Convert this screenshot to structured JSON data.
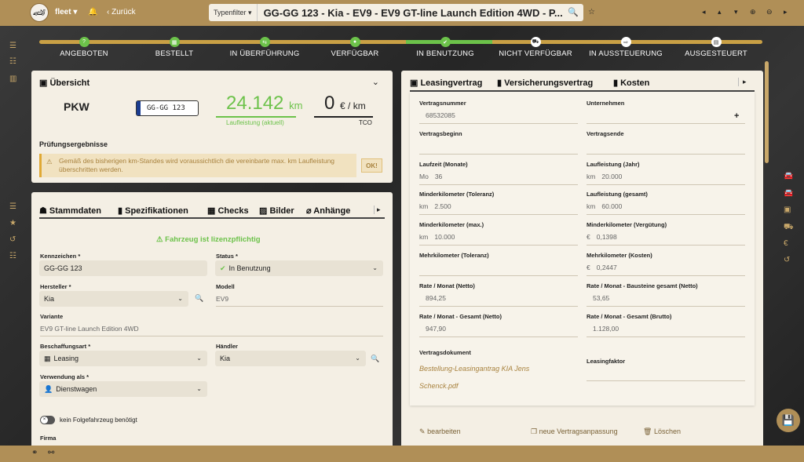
{
  "topbar": {
    "user": "fleet",
    "back_label": "Zurück",
    "filter_label": "Typenfilter",
    "title": "GG-GG 123 - Kia - EV9 - EV9 GT-line Launch Edition 4WD - P...",
    "avatar_icon": "avatar-driver-icon",
    "bell_icon": "bell-icon",
    "search_icon": "search-icon",
    "star_icon": "star-icon"
  },
  "progress": {
    "steps": [
      {
        "label": "ANGEBOTEN",
        "icon": "?"
      },
      {
        "label": "BESTELLT",
        "icon": "▦"
      },
      {
        "label": "IN ÜBERFÜHRUNG",
        "icon": "⇆"
      },
      {
        "label": "VERFÜGBAR",
        "icon": "●"
      },
      {
        "label": "IN BENUTZUNG",
        "icon": "✔"
      },
      {
        "label": "NICHT VERFÜGBAR",
        "icon": "⛟"
      },
      {
        "label": "IN AUSSTEUERUNG",
        "icon": "⇨"
      },
      {
        "label": "AUSGESTEUERT",
        "icon": "▤"
      }
    ]
  },
  "overview": {
    "title": "Übersicht",
    "vehicle_type": "PKW",
    "plate": "GG-GG 123",
    "mileage_value": "24.142",
    "mileage_unit": "km",
    "mileage_label": "Laufleistung (aktuell)",
    "tco_value": "0",
    "tco_unit": "€ / km",
    "tco_label": "TCO",
    "check_title": "Prüfungsergebnisse",
    "warning_text": "Gemäß des bisherigen km-Standes wird voraussichtlich die vereinbarte max. km Laufleistung überschritten werden.",
    "ok_button": "OK!"
  },
  "master": {
    "tabs": [
      "Stammdaten",
      "Spezifikationen",
      "Checks",
      "Bilder",
      "Anhänge"
    ],
    "license_notice": "Fahrzeug ist lizenzpflichtig",
    "fields": {
      "kennzeichen_label": "Kennzeichen *",
      "kennzeichen_value": "GG-GG 123",
      "status_label": "Status *",
      "status_value": "In Benutzung",
      "hersteller_label": "Hersteller *",
      "hersteller_value": "Kia",
      "modell_label": "Modell",
      "modell_value": "EV9",
      "variante_label": "Variante",
      "variante_value": "EV9 GT-line Launch Edition 4WD",
      "beschaffung_label": "Beschaffungsart *",
      "beschaffung_value": "Leasing",
      "haendler_label": "Händler",
      "haendler_value": "Kia",
      "verwendung_label": "Verwendung als *",
      "verwendung_value": "Dienstwagen",
      "toggle_label": "kein Folgefahrzeug benötigt",
      "firma_label": "Firma"
    }
  },
  "contract": {
    "tabs": [
      "Leasingvertrag",
      "Versicherungsvertrag",
      "Kosten"
    ],
    "left": [
      {
        "label": "Vertragsnummer",
        "prefix": "",
        "value": "68532085"
      },
      {
        "label": "Vertragsbeginn",
        "prefix": "",
        "value": ""
      },
      {
        "label": "Laufzeit (Monate)",
        "prefix": "Mo",
        "value": "36"
      },
      {
        "label": "Minderkilometer (Toleranz)",
        "prefix": "km",
        "value": "2.500"
      },
      {
        "label": "Minderkilometer (max.)",
        "prefix": "km",
        "value": "10.000"
      },
      {
        "label": "Mehrkilometer (Toleranz)",
        "prefix": "",
        "value": ""
      },
      {
        "label": "Rate / Monat (Netto)",
        "prefix": "",
        "value": "894,25"
      },
      {
        "label": "Rate / Monat - Gesamt (Netto)",
        "prefix": "",
        "value": "947,90"
      }
    ],
    "right": [
      {
        "label": "Unternehmen",
        "prefix": "",
        "value": ""
      },
      {
        "label": "Vertragsende",
        "prefix": "",
        "value": ""
      },
      {
        "label": "Laufleistung (Jahr)",
        "prefix": "km",
        "value": "20.000"
      },
      {
        "label": "Laufleistung (gesamt)",
        "prefix": "km",
        "value": "60.000"
      },
      {
        "label": "Minderkilometer (Vergütung)",
        "prefix": "€",
        "value": "0,1398"
      },
      {
        "label": "Mehrkilometer (Kosten)",
        "prefix": "€",
        "value": "0,2447"
      },
      {
        "label": "Rate / Monat - Bausteine gesamt (Netto)",
        "prefix": "",
        "value": "53,65"
      },
      {
        "label": "Rate / Monat - Gesamt (Brutto)",
        "prefix": "",
        "value": "1.128,00"
      }
    ],
    "doc_label": "Vertragsdokument",
    "doc_link_line1": "Bestellung-Leasingantrag KIA Jens",
    "doc_link_line2": "Schenck.pdf",
    "factor_label": "Leasingfaktor",
    "actions": {
      "edit": "bearbeiten",
      "adjust": "neue Vertragsanpassung",
      "delete": "Löschen"
    }
  },
  "colors": {
    "brand": "#b08f57",
    "accent_green": "#6cc24a",
    "panel": "#f4efe4"
  }
}
